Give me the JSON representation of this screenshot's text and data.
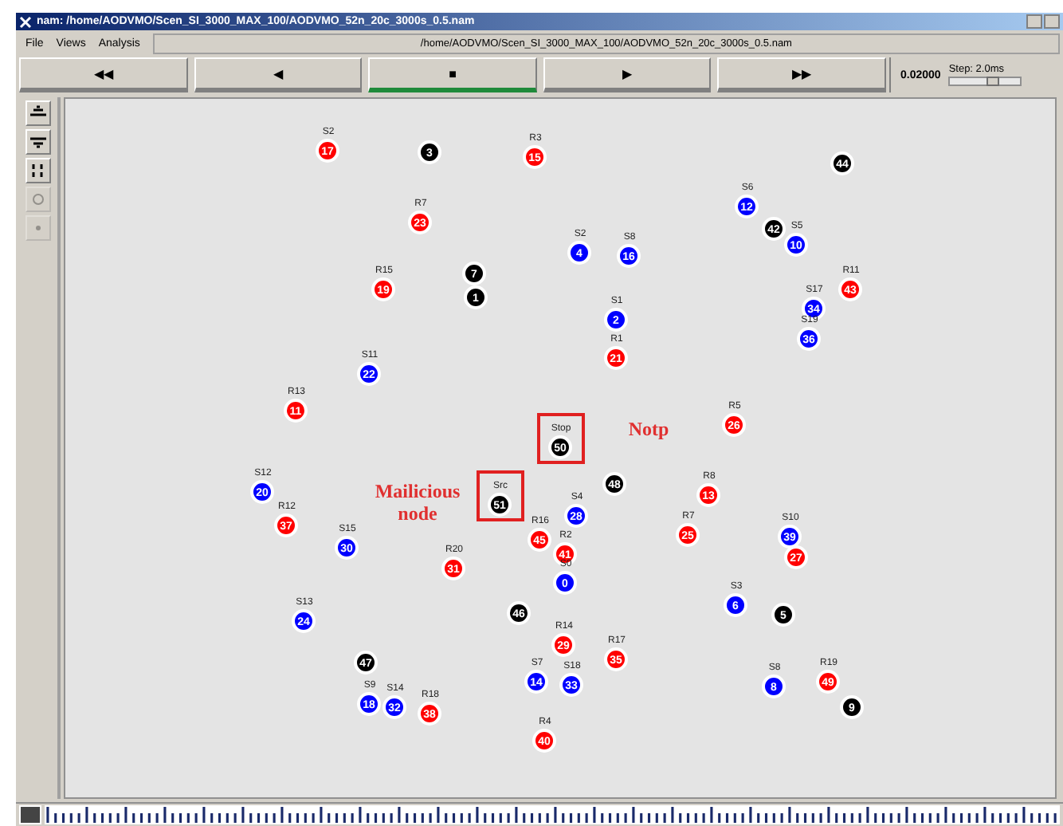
{
  "window": {
    "title": "nam: /home/AODVMO/Scen_SI_3000_MAX_100/AODVMO_52n_20c_3000s_0.5.nam"
  },
  "menu": [
    "File",
    "Views",
    "Analysis"
  ],
  "file_path": "/home/AODVMO/Scen_SI_3000_MAX_100/AODVMO_52n_20c_3000s_0.5.nam",
  "playback": [
    {
      "label": "◀◀",
      "selected": false
    },
    {
      "label": "◀",
      "selected": false
    },
    {
      "label": "■",
      "selected": true
    },
    {
      "label": "▶",
      "selected": false
    },
    {
      "label": "▶▶",
      "selected": false
    }
  ],
  "time": "0.02000",
  "step": {
    "label": "Step: 2.0ms",
    "level": 0.6
  },
  "tools": [
    {
      "disabled": false
    },
    {
      "disabled": false
    },
    {
      "disabled": false
    },
    {
      "disabled": true
    },
    {
      "disabled": true
    }
  ],
  "nodes": [
    {
      "number": "17",
      "label": "S2",
      "color": "#ff0000"
    },
    {
      "number": "3",
      "color": "#000000"
    },
    {
      "number": "15",
      "label": "R3",
      "color": "#ff0000"
    },
    {
      "number": "44",
      "color": "#000000"
    },
    {
      "number": "12",
      "label": "S6",
      "color": "#0000ff"
    },
    {
      "number": "23",
      "label": "R7",
      "color": "#ff0000"
    },
    {
      "number": "42",
      "color": "#000000"
    },
    {
      "number": "4",
      "label": "S2",
      "color": "#0000ff"
    },
    {
      "number": "16",
      "label": "S8",
      "color": "#0000ff"
    },
    {
      "number": "10",
      "label": "S5",
      "color": "#0000ff"
    },
    {
      "number": "19",
      "label": "R15",
      "color": "#ff0000"
    },
    {
      "number": "7",
      "color": "#000000"
    },
    {
      "number": "1",
      "color": "#000000"
    },
    {
      "number": "43",
      "label": "R11",
      "color": "#ff0000"
    },
    {
      "number": "2",
      "label": "S1",
      "color": "#0000ff"
    },
    {
      "number": "34",
      "label": "S17",
      "color": "#0000ff"
    },
    {
      "number": "36",
      "label": "S19",
      "color": "#0000ff"
    },
    {
      "number": "21",
      "label": "R1",
      "color": "#ff0000"
    },
    {
      "number": "22",
      "label": "S11",
      "color": "#0000ff"
    },
    {
      "number": "11",
      "label": "R13",
      "color": "#ff0000"
    },
    {
      "number": "26",
      "label": "R5",
      "color": "#ff0000"
    },
    {
      "number": "50",
      "label": "Stop",
      "color": "#000000",
      "highlighted": true
    },
    {
      "number": "20",
      "label": "S12",
      "color": "#0000ff"
    },
    {
      "number": "48",
      "color": "#000000"
    },
    {
      "number": "13",
      "label": "R8",
      "color": "#ff0000"
    },
    {
      "number": "51",
      "label": "Src",
      "color": "#000000",
      "highlighted": true
    },
    {
      "number": "37",
      "label": "R12",
      "color": "#ff0000"
    },
    {
      "number": "28",
      "label": "S4",
      "color": "#0000ff"
    },
    {
      "number": "30",
      "label": "S15",
      "color": "#0000ff"
    },
    {
      "number": "45",
      "label": "R16",
      "color": "#ff0000"
    },
    {
      "number": "25",
      "label": "R7",
      "color": "#ff0000"
    },
    {
      "number": "39",
      "label": "S10",
      "color": "#0000ff"
    },
    {
      "number": "31",
      "label": "R20",
      "color": "#ff0000"
    },
    {
      "number": "41",
      "label": "R2",
      "color": "#ff0000"
    },
    {
      "number": "27",
      "color": "#ff0000"
    },
    {
      "number": "0",
      "label": "S0",
      "color": "#0000ff"
    },
    {
      "number": "24",
      "label": "S13",
      "color": "#0000ff"
    },
    {
      "number": "46",
      "color": "#000000"
    },
    {
      "number": "6",
      "label": "S3",
      "color": "#0000ff"
    },
    {
      "number": "5",
      "color": "#000000"
    },
    {
      "number": "29",
      "label": "R14",
      "color": "#ff0000"
    },
    {
      "number": "47",
      "color": "#000000"
    },
    {
      "number": "35",
      "label": "R17",
      "color": "#ff0000"
    },
    {
      "number": "14",
      "label": "S7",
      "color": "#0000ff"
    },
    {
      "number": "33",
      "label": "S18",
      "color": "#0000ff"
    },
    {
      "number": "8",
      "label": "S8",
      "color": "#0000ff"
    },
    {
      "number": "49",
      "label": "R19",
      "color": "#ff0000"
    },
    {
      "number": "18",
      "label": "S9",
      "color": "#0000ff"
    },
    {
      "number": "32",
      "label": "S14",
      "color": "#0000ff"
    },
    {
      "number": "38",
      "label": "R18",
      "color": "#ff0000"
    },
    {
      "number": "9",
      "color": "#000000"
    },
    {
      "number": "40",
      "label": "R4",
      "color": "#ff0000"
    }
  ],
  "annotations": [
    "Notp",
    "Mailicious node"
  ]
}
